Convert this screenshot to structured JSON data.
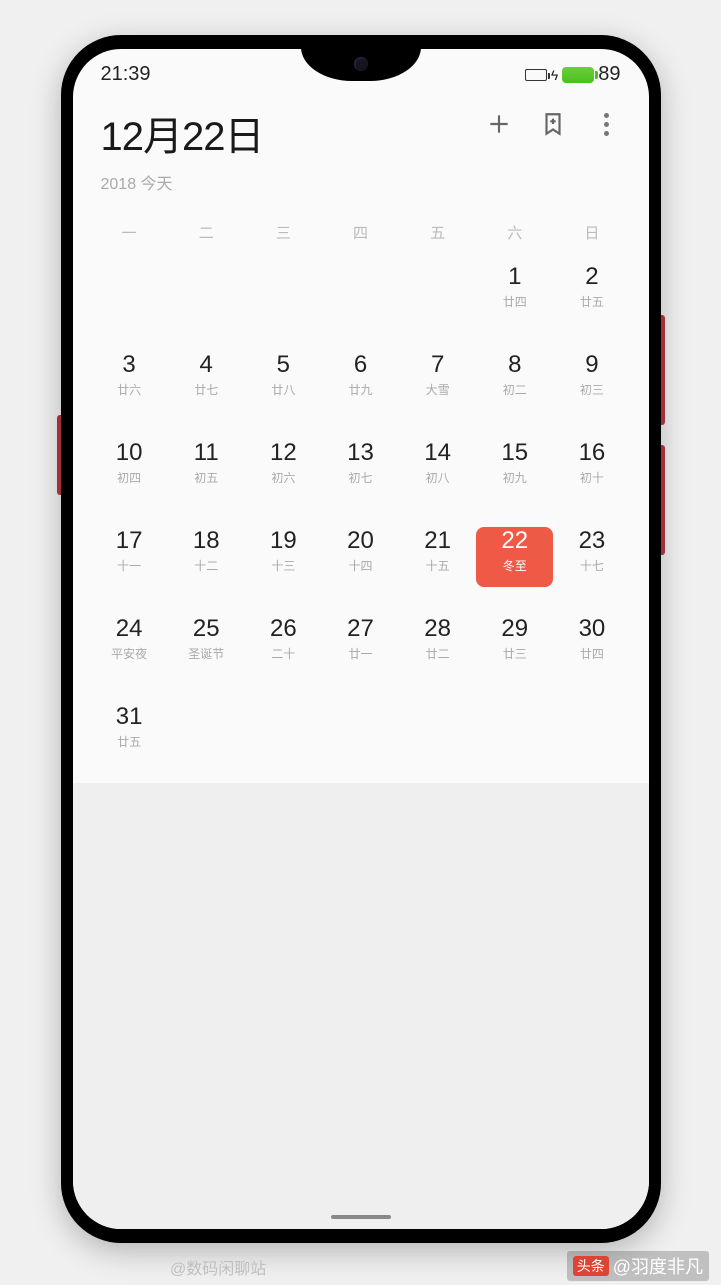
{
  "status": {
    "time": "21:39",
    "battery": "89"
  },
  "header": {
    "title": "12月22日",
    "subtitle": "2018 今天"
  },
  "weekdays": [
    "一",
    "二",
    "三",
    "四",
    "五",
    "六",
    "日"
  ],
  "days": [
    {
      "n": "",
      "s": ""
    },
    {
      "n": "",
      "s": ""
    },
    {
      "n": "",
      "s": ""
    },
    {
      "n": "",
      "s": ""
    },
    {
      "n": "",
      "s": ""
    },
    {
      "n": "1",
      "s": "廿四"
    },
    {
      "n": "2",
      "s": "廿五"
    },
    {
      "n": "3",
      "s": "廿六"
    },
    {
      "n": "4",
      "s": "廿七"
    },
    {
      "n": "5",
      "s": "廿八"
    },
    {
      "n": "6",
      "s": "廿九"
    },
    {
      "n": "7",
      "s": "大雪"
    },
    {
      "n": "8",
      "s": "初二"
    },
    {
      "n": "9",
      "s": "初三"
    },
    {
      "n": "10",
      "s": "初四"
    },
    {
      "n": "11",
      "s": "初五"
    },
    {
      "n": "12",
      "s": "初六"
    },
    {
      "n": "13",
      "s": "初七"
    },
    {
      "n": "14",
      "s": "初八"
    },
    {
      "n": "15",
      "s": "初九"
    },
    {
      "n": "16",
      "s": "初十"
    },
    {
      "n": "17",
      "s": "十一"
    },
    {
      "n": "18",
      "s": "十二"
    },
    {
      "n": "19",
      "s": "十三"
    },
    {
      "n": "20",
      "s": "十四"
    },
    {
      "n": "21",
      "s": "十五"
    },
    {
      "n": "22",
      "s": "冬至",
      "sel": true
    },
    {
      "n": "23",
      "s": "十七"
    },
    {
      "n": "24",
      "s": "平安夜"
    },
    {
      "n": "25",
      "s": "圣诞节"
    },
    {
      "n": "26",
      "s": "二十"
    },
    {
      "n": "27",
      "s": "廿一"
    },
    {
      "n": "28",
      "s": "廿二"
    },
    {
      "n": "29",
      "s": "廿三"
    },
    {
      "n": "30",
      "s": "廿四"
    },
    {
      "n": "31",
      "s": "廿五"
    }
  ],
  "watermark": {
    "left": "@数码闲聊站",
    "right_prefix": "头条",
    "right_handle": "@羽度非凡"
  }
}
